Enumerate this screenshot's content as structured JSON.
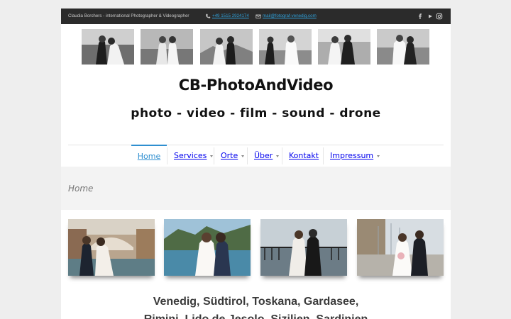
{
  "topbar": {
    "owner": "Claudia Borchers - international Photographer & Videographer",
    "phone": "+49 1515 2924174",
    "email": "mail@fotograf-venedig.com",
    "social_icons": [
      "facebook-icon",
      "youtube-icon",
      "instagram-icon"
    ]
  },
  "gallery_strip": [
    "wedding-photo",
    "wedding-photo",
    "wedding-photo",
    "wedding-photo",
    "wedding-photo",
    "wedding-photo"
  ],
  "site": {
    "title": "CB-PhotoAndVideo",
    "tagline": "photo - video - film - sound - drone"
  },
  "nav": {
    "items": [
      {
        "label": "Home",
        "active": true,
        "dropdown": false
      },
      {
        "label": "Services",
        "active": false,
        "dropdown": true
      },
      {
        "label": "Orte",
        "active": false,
        "dropdown": true
      },
      {
        "label": "Über",
        "active": false,
        "dropdown": true
      },
      {
        "label": "Kontakt",
        "active": false,
        "dropdown": false
      },
      {
        "label": "Impressum",
        "active": false,
        "dropdown": true
      }
    ]
  },
  "breadcrumb": "Home",
  "main": {
    "photos": [
      "venice-wedding-photo",
      "coast-wedding-photo",
      "pier-wedding-photo",
      "harbor-wedding-photo"
    ],
    "locations_line1": "Venedig, Südtirol, Toskana, Gardasee,",
    "locations_line2": "Rimini, Lido de Jesolo, Sizilien, Sardinien"
  },
  "colors": {
    "accent": "#2f8fd0",
    "topbar_bg": "#2b2b2b",
    "page_bg": "#eeeeee",
    "band_bg": "#f3f3f3"
  }
}
